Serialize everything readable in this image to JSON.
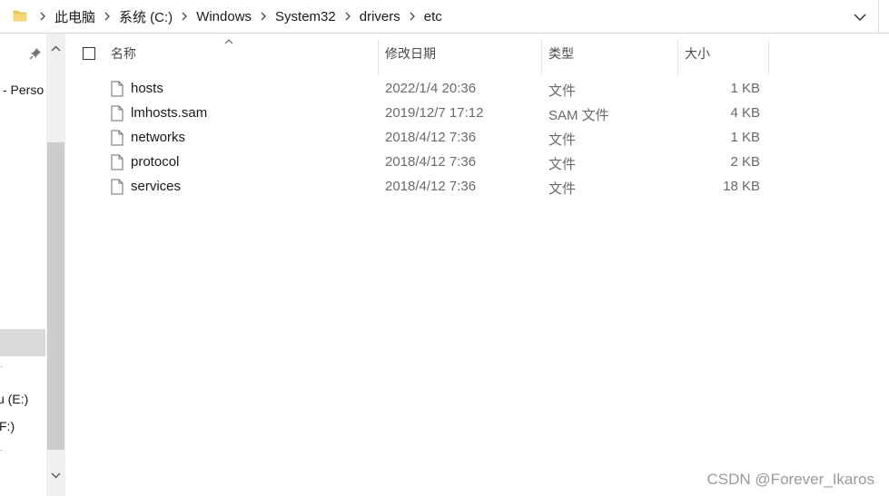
{
  "addressbar": {
    "crumbs": [
      "此电脑",
      "系统 (C:)",
      "Windows",
      "System32",
      "drivers",
      "etc"
    ]
  },
  "navpane": {
    "item_person": "- Perso",
    "item_drive_e": "u (E:)",
    "item_drive_f": "F:)"
  },
  "columns": {
    "name": "名称",
    "date": "修改日期",
    "type": "类型",
    "size": "大小"
  },
  "files": [
    {
      "name": "hosts",
      "date": "2022/1/4 20:36",
      "type": "文件",
      "size": "1 KB"
    },
    {
      "name": "lmhosts.sam",
      "date": "2019/12/7 17:12",
      "type": "SAM 文件",
      "size": "4 KB"
    },
    {
      "name": "networks",
      "date": "2018/4/12 7:36",
      "type": "文件",
      "size": "1 KB"
    },
    {
      "name": "protocol",
      "date": "2018/4/12 7:36",
      "type": "文件",
      "size": "2 KB"
    },
    {
      "name": "services",
      "date": "2018/4/12 7:36",
      "type": "文件",
      "size": "18 KB"
    }
  ],
  "watermark": "CSDN @Forever_Ikaros",
  "colors": {
    "folder": "#f2c94c",
    "selection": "#d9d9d9",
    "scrollbar_thumb": "#cdcdcd"
  }
}
